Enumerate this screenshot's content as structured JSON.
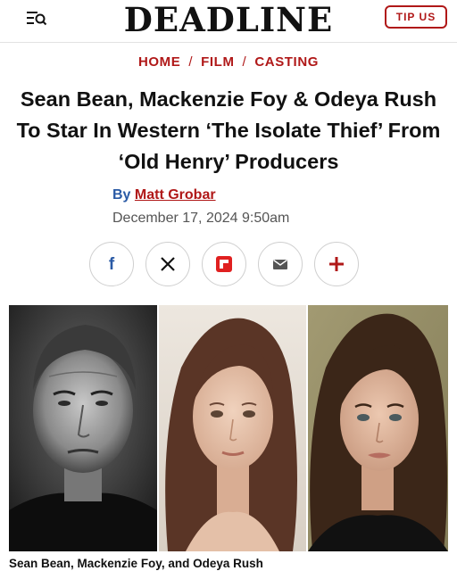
{
  "header": {
    "logo": "DEADLINE",
    "tip_label": "TIP US",
    "menu_icon": "menu-search-icon"
  },
  "breadcrumb": {
    "items": [
      "HOME",
      "FILM",
      "CASTING"
    ],
    "separator": "/"
  },
  "article": {
    "headline": "Sean Bean, Mackenzie Foy & Odeya Rush To Star In Western ‘The Isolate Thief’ From ‘Old Henry’ Producers",
    "by_prefix": "By",
    "author": "Matt Grobar",
    "date": "December 17, 2024 9:50am"
  },
  "share": {
    "buttons": [
      "facebook-icon",
      "x-icon",
      "flipboard-icon",
      "email-icon",
      "plus-icon"
    ]
  },
  "image": {
    "caption": "Sean Bean, Mackenzie Foy, and Odeya Rush"
  },
  "colors": {
    "accent": "#b01818",
    "byline_blue": "#2a5aa5",
    "facebook": "#2a5aa5"
  }
}
